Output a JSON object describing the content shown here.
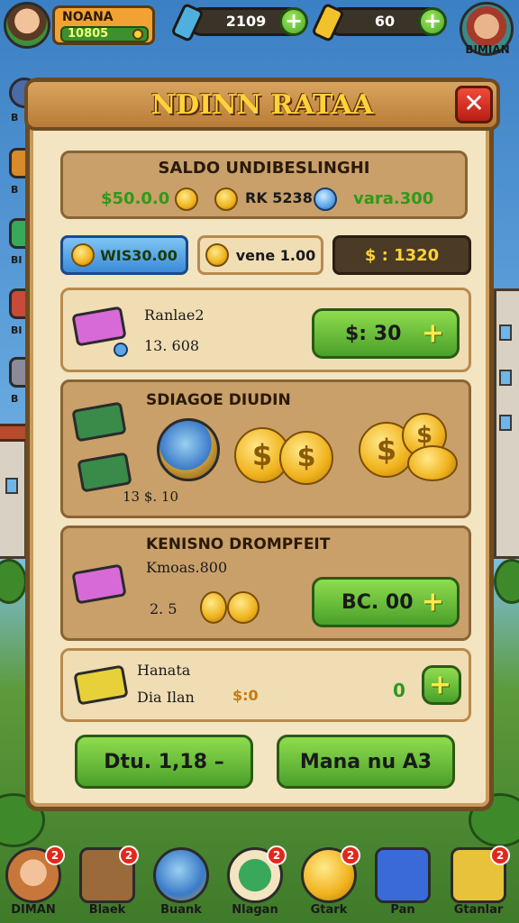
{
  "hud": {
    "player_name": "NOANA",
    "player_level": "10805",
    "resource1_value": "2109",
    "resource2_value": "60",
    "top_right_label": "BIMIAN",
    "add_label": "+"
  },
  "side_labels": [
    "B",
    "B",
    "BI",
    "BI",
    "B"
  ],
  "dialog": {
    "title": "NDINN RATAA",
    "close_label": "✕"
  },
  "balance": {
    "title": "SALDO UNDIBESLINGHI",
    "amount1": "$50.0.0",
    "amount2": "RK 5238",
    "amount3": "vara.300"
  },
  "tabs": [
    {
      "label": "WIS30.00"
    },
    {
      "label": "vene 1.00"
    },
    {
      "label": "$ :  1320"
    }
  ],
  "item1": {
    "name": "Ranlae2",
    "value": "13. 608",
    "button_label": "$: 30"
  },
  "item2": {
    "title": "SDIAGOE DIUDIN",
    "value": "13 $. 10"
  },
  "item3": {
    "title": "KENISNO DROMPFEIT",
    "subtitle": "Kmoas.800",
    "value": "2. 5",
    "button_label": "BC. 00"
  },
  "item4": {
    "name": "Hanata",
    "subname": "Dia Ilan",
    "coin_label": "$:0",
    "count": "0"
  },
  "footer": {
    "left_button": "Dtu. 1,18  –",
    "right_button": "Mana nu A3"
  },
  "bottom_nav": [
    {
      "label": "DIMAN",
      "badge": "2",
      "color": "#c8773a"
    },
    {
      "label": "Blaek",
      "badge": "2",
      "color": "#9a6a3a"
    },
    {
      "label": "Buank",
      "badge": "",
      "color": "#3a7ac8"
    },
    {
      "label": "Nlagan",
      "badge": "2",
      "color": "#3aa85a"
    },
    {
      "label": "Gtark",
      "badge": "2",
      "color": "#e0b22a"
    },
    {
      "label": "Pan",
      "badge": "",
      "color": "#3a6ad8"
    },
    {
      "label": "Gtanlar",
      "badge": "2",
      "color": "#e8c23a"
    }
  ]
}
